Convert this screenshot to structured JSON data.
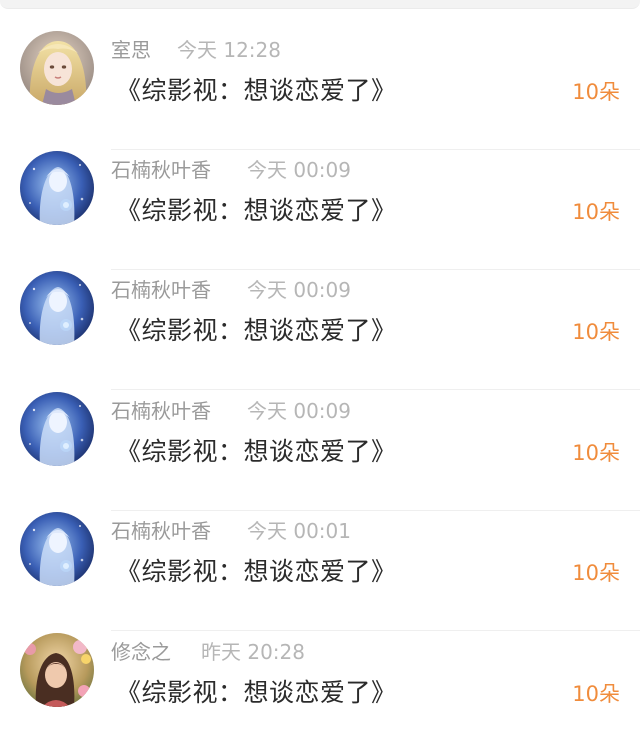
{
  "records": [
    {
      "username": "室思",
      "time": "今天 12:28",
      "title": "《综影视：想谈恋爱了》",
      "amount": "10朵",
      "avatar_icon": "avatar-blonde-girl-icon"
    },
    {
      "username": "石楠秋叶香",
      "time": "今天 00:09",
      "title": "《综影视：想谈恋爱了》",
      "amount": "10朵",
      "avatar_icon": "avatar-blue-fairy-icon"
    },
    {
      "username": "石楠秋叶香",
      "time": "今天 00:09",
      "title": "《综影视：想谈恋爱了》",
      "amount": "10朵",
      "avatar_icon": "avatar-blue-fairy-icon"
    },
    {
      "username": "石楠秋叶香",
      "time": "今天 00:09",
      "title": "《综影视：想谈恋爱了》",
      "amount": "10朵",
      "avatar_icon": "avatar-blue-fairy-icon"
    },
    {
      "username": "石楠秋叶香",
      "time": "今天 00:01",
      "title": "《综影视：想谈恋爱了》",
      "amount": "10朵",
      "avatar_icon": "avatar-blue-fairy-icon"
    },
    {
      "username": "修念之",
      "time": "昨天 20:28",
      "title": "《综影视：想谈恋爱了》",
      "amount": "10朵",
      "avatar_icon": "avatar-girl-flowers-icon"
    }
  ],
  "colors": {
    "accent_amount": "#f08c3c",
    "username": "#9a9a9a",
    "time": "#b6b6b6",
    "title": "#2b2b2b"
  }
}
